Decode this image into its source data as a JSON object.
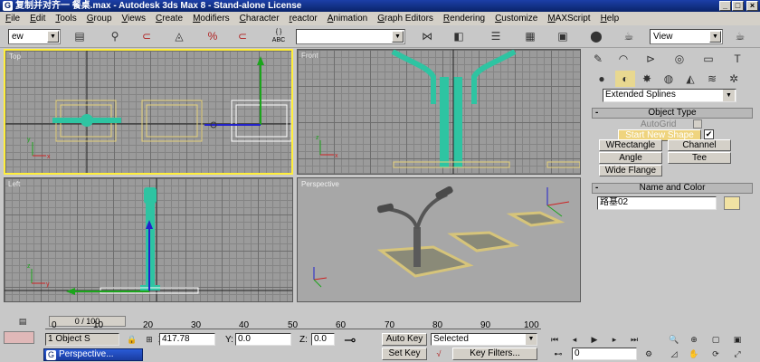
{
  "window": {
    "title": "复制并对齐一 餐桌.max - Autodesk 3ds Max 8  - Stand-alone License",
    "minimize": "_",
    "maximize": "□",
    "close": "×"
  },
  "menu": [
    "File",
    "Edit",
    "Tools",
    "Group",
    "Views",
    "Create",
    "Modifiers",
    "Character",
    "reactor",
    "Animation",
    "Graph Editors",
    "Rendering",
    "Customize",
    "MAXScript",
    "Help"
  ],
  "toolbar": {
    "selection_filter": "ew",
    "named_selection": "",
    "reference_coord": "View",
    "undo_icon": "undo-icon",
    "abc_label": "ABC"
  },
  "viewports": {
    "top": "Top",
    "front": "Front",
    "left": "Left",
    "perspective": "Perspective"
  },
  "command_panel": {
    "category": "Extended Splines",
    "object_type_title": "Object Type",
    "autogrid_label": "AutoGrid",
    "start_new_shape": "Start New Shape",
    "buttons": [
      "WRectangle",
      "Channel",
      "Angle",
      "Tee",
      "Wide Flange"
    ],
    "name_color_title": "Name and Color",
    "object_name": "路基02",
    "object_color": "#f1e2a3"
  },
  "timeline": {
    "slider_label": "0 / 100",
    "ticks": [
      "0",
      "10",
      "20",
      "30",
      "40",
      "50",
      "60",
      "70",
      "80",
      "90",
      "100"
    ]
  },
  "status": {
    "selection_count": "1 Object S",
    "x_label": "X:",
    "x_value": "417.78",
    "y_label": "Y:",
    "y_value": "0.0",
    "z_label": "Z:",
    "z_value": "0.0",
    "auto_key": "Auto Key",
    "set_key": "Set Key",
    "key_mode": "Selected",
    "key_filters": "Key Filters...",
    "frame": "0",
    "taskbar_label": "Perspective..."
  }
}
